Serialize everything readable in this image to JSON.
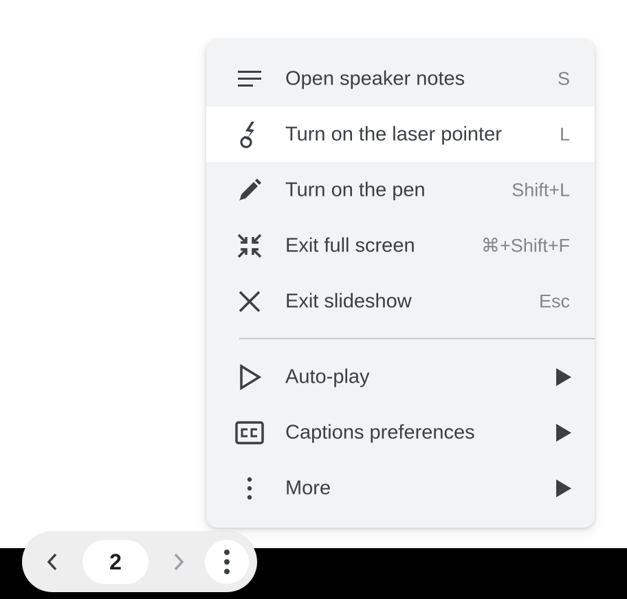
{
  "menu": {
    "items": [
      {
        "label": "Open speaker notes",
        "shortcut": "S",
        "icon": "notes-icon"
      },
      {
        "label": "Turn on the laser pointer",
        "shortcut": "L",
        "icon": "laser-pointer-icon"
      },
      {
        "label": "Turn on the pen",
        "shortcut": "Shift+L",
        "icon": "pen-icon"
      },
      {
        "label": "Exit full screen",
        "shortcut": "⌘+Shift+F",
        "icon": "exit-fullscreen-icon"
      },
      {
        "label": "Exit slideshow",
        "shortcut": "Esc",
        "icon": "close-icon"
      },
      {
        "label": "Auto-play",
        "icon": "play-outline-icon"
      },
      {
        "label": "Captions preferences",
        "icon": "closed-captions-icon"
      },
      {
        "label": "More",
        "icon": "more-vert-icon"
      }
    ]
  },
  "nav": {
    "page_number": "2",
    "prev_icon": "chevron-left-icon",
    "next_icon": "chevron-right-icon",
    "menu_icon": "more-vert-icon"
  },
  "colors": {
    "menu_background": "#f1f3f4",
    "highlight": "#ffffff",
    "text": "#3c4043",
    "shortcut_text": "#80868b",
    "bottom_bar": "#000000"
  }
}
